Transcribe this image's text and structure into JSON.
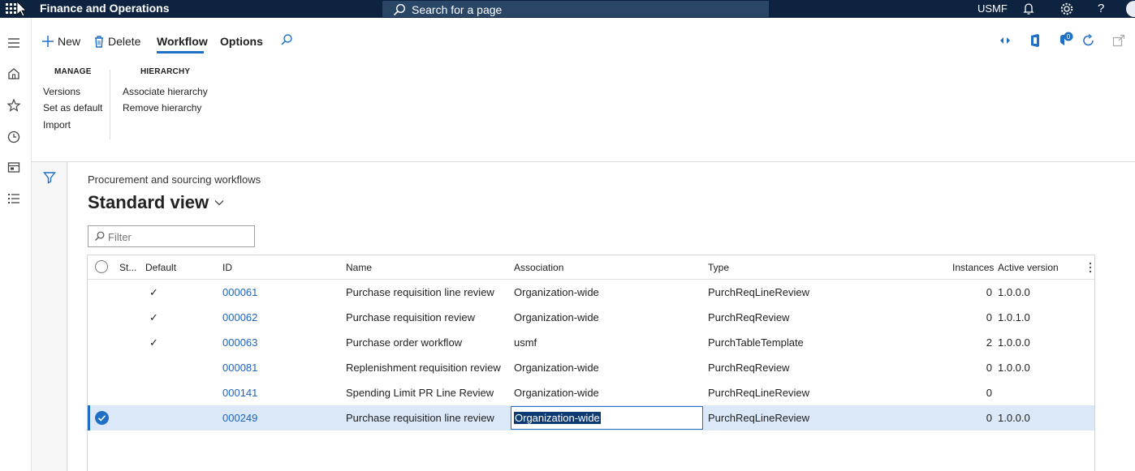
{
  "topbar": {
    "app_title": "Finance and Operations",
    "search_placeholder": "Search for a page",
    "company": "USMF"
  },
  "actionpane": {
    "new_label": "New",
    "delete_label": "Delete",
    "tabs": [
      "Workflow",
      "Options"
    ],
    "selected_tab": "Workflow",
    "groups": {
      "manage": {
        "title": "MANAGE",
        "items": [
          "Versions",
          "Set as default",
          "Import"
        ]
      },
      "hierarchy": {
        "title": "HIERARCHY",
        "items": [
          "Associate hierarchy",
          "Remove hierarchy"
        ]
      }
    },
    "notification_count": "0"
  },
  "page": {
    "caption": "Procurement and sourcing workflows",
    "view_name": "Standard view",
    "filter_placeholder": "Filter"
  },
  "grid": {
    "columns": {
      "status": "St...",
      "default": "Default",
      "id": "ID",
      "name": "Name",
      "association": "Association",
      "type": "Type",
      "instances": "Instances",
      "active_version": "Active version"
    },
    "rows": [
      {
        "default": "✓",
        "id": "000061",
        "name": "Purchase requisition line review",
        "association": "Organization-wide",
        "type": "PurchReqLineReview",
        "instances": "0",
        "active_version": "1.0.0.0"
      },
      {
        "default": "✓",
        "id": "000062",
        "name": "Purchase requisition review",
        "association": "Organization-wide",
        "type": "PurchReqReview",
        "instances": "0",
        "active_version": "1.0.1.0"
      },
      {
        "default": "✓",
        "id": "000063",
        "name": "Purchase order workflow",
        "association": "usmf",
        "type": "PurchTableTemplate",
        "instances": "2",
        "active_version": "1.0.0.0"
      },
      {
        "default": "",
        "id": "000081",
        "name": "Replenishment requisition review",
        "association": "Organization-wide",
        "type": "PurchReqReview",
        "instances": "0",
        "active_version": "1.0.0.0"
      },
      {
        "default": "",
        "id": "000141",
        "name": "Spending Limit PR Line Review",
        "association": "Organization-wide",
        "type": "PurchReqLineReview",
        "instances": "0",
        "active_version": ""
      },
      {
        "default": "",
        "id": "000249",
        "name": "Purchase requisition line review",
        "association": "Organization-wide",
        "type": "PurchReqLineReview",
        "instances": "0",
        "active_version": "1.0.0.0"
      }
    ],
    "selected_row_index": 5
  }
}
